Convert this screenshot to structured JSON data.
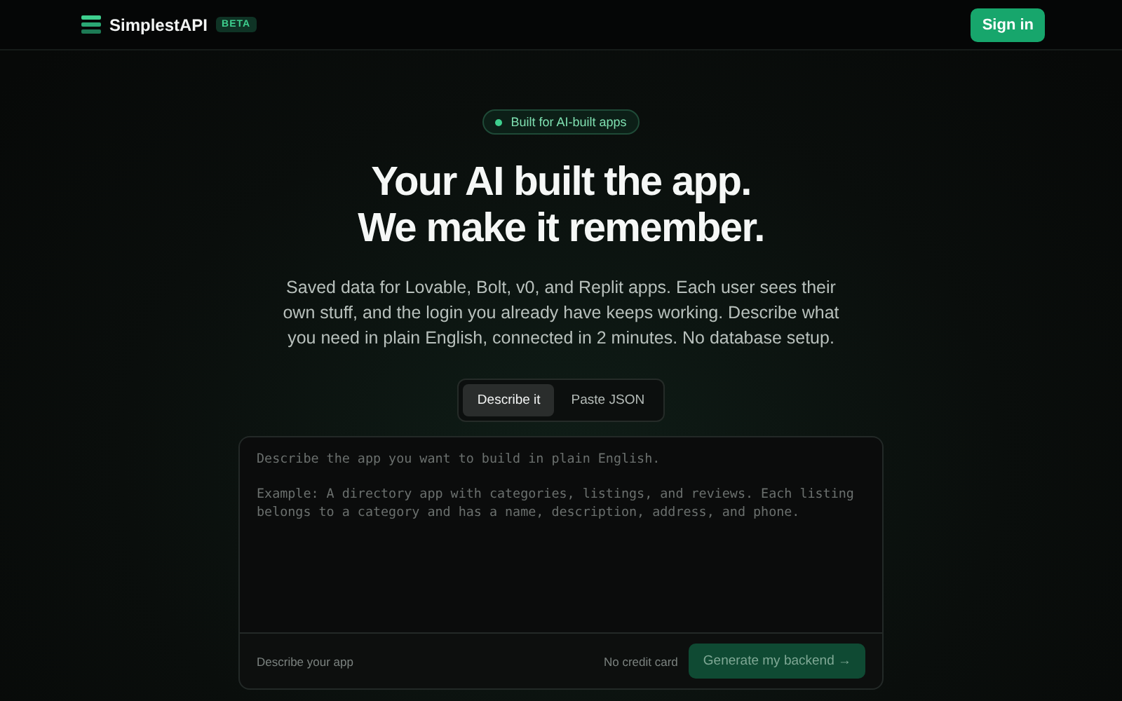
{
  "header": {
    "brand": "SimplestAPI",
    "badge": "BETA",
    "sign_in": "Sign in"
  },
  "hero": {
    "pill": "Built for AI-built apps",
    "title_lines": [
      "Your AI built the app.",
      "We make it remember."
    ],
    "description": "Saved data for Lovable, Bolt, v0, and Replit apps. Each user sees their own stuff, and the login you already have keeps working. Describe what you need in plain English, connected in 2 minutes. No database setup."
  },
  "tabs": [
    {
      "label": "Describe it",
      "selected": true
    },
    {
      "label": "Paste JSON",
      "selected": false
    }
  ],
  "prompt": {
    "placeholder": "Describe the app you want to build in plain English.\n\nExample: A directory app with categories, listings, and reviews. Each listing belongs to a category and has a name, description, address, and phone.",
    "hint": "Describe your app",
    "note": "No credit card",
    "button": {
      "label": "Generate my backend →",
      "disabled": true
    }
  }
}
